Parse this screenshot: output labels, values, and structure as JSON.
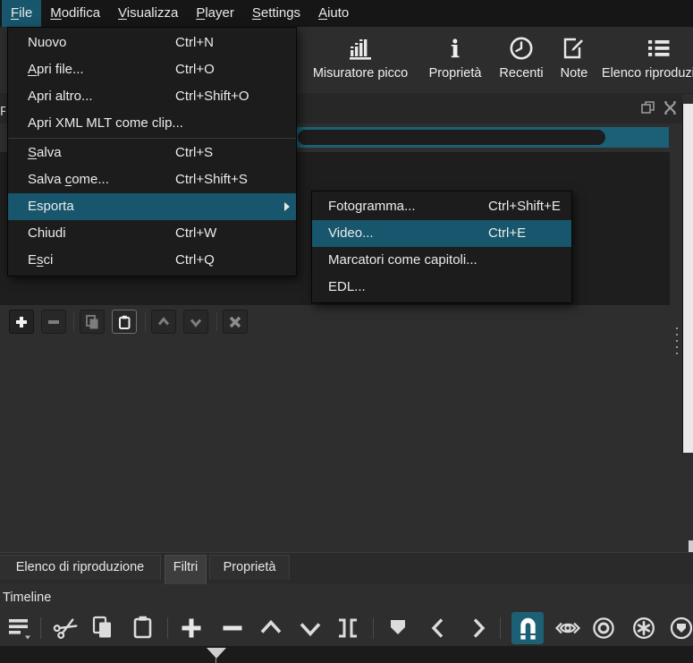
{
  "colors": {
    "accent_menu": "#17566c",
    "accent_search": "#1c6075",
    "menubar_bg": "#161616",
    "menu_bg": "#1c1c1c",
    "panel_bg": "#2e2e2e",
    "dark_list_bg": "#1e1e1e",
    "timeline_strip_bg": "#1b1b1b"
  },
  "menubar": {
    "items": [
      {
        "pre": "",
        "key": "F",
        "post": "ile"
      },
      {
        "pre": "",
        "key": "M",
        "post": "odifica"
      },
      {
        "pre": "",
        "key": "V",
        "post": "isualizza"
      },
      {
        "pre": "",
        "key": "P",
        "post": "layer"
      },
      {
        "pre": "",
        "key": "S",
        "post": "ettings"
      },
      {
        "pre": "",
        "key": "A",
        "post": "iuto"
      }
    ]
  },
  "toolbar": {
    "items": [
      {
        "label": "Misuratore picco",
        "icon": "peak-meter-icon"
      },
      {
        "label": "Proprietà",
        "icon": "info-icon"
      },
      {
        "label": "Recenti",
        "icon": "clock-icon"
      },
      {
        "label": "Note",
        "icon": "note-icon"
      },
      {
        "label": "Elenco riproduzione",
        "icon": "playlist-icon"
      }
    ]
  },
  "file_menu": {
    "items": [
      {
        "pre": "Nuovo",
        "key": "",
        "post": "",
        "shortcut": "Ctrl+N"
      },
      {
        "pre": "",
        "key": "A",
        "post": "pri file...",
        "shortcut": "Ctrl+O"
      },
      {
        "pre": "Apri altro...",
        "key": "",
        "post": "",
        "shortcut": "Ctrl+Shift+O"
      },
      {
        "pre": "Apri XML MLT come clip...",
        "key": "",
        "post": "",
        "shortcut": ""
      },
      {
        "pre": "",
        "key": "S",
        "post": "alva",
        "shortcut": "Ctrl+S"
      },
      {
        "pre": "Salva ",
        "key": "c",
        "post": "ome...",
        "shortcut": "Ctrl+Shift+S"
      },
      {
        "pre": "Esporta",
        "key": "",
        "post": "",
        "shortcut": "",
        "has_submenu": true,
        "highlighted": true
      },
      {
        "pre": "Chiudi",
        "key": "",
        "post": "",
        "shortcut": "Ctrl+W"
      },
      {
        "pre": "E",
        "key": "s",
        "post": "ci",
        "shortcut": "Ctrl+Q"
      }
    ]
  },
  "export_submenu": {
    "items": [
      {
        "label": "Fotogramma...",
        "shortcut": "Ctrl+Shift+E"
      },
      {
        "label": "Video...",
        "shortcut": "Ctrl+E",
        "highlighted": true
      },
      {
        "label": "Marcatori come capitoli...",
        "shortcut": ""
      },
      {
        "label": "EDL...",
        "shortcut": ""
      }
    ]
  },
  "filters_panel": {
    "header_fragment": "F",
    "search_value": "",
    "window_controls": [
      "float-icon",
      "close-icon"
    ],
    "buttons": [
      "add-filter",
      "remove-filter",
      "copy-filter",
      "paste-filter",
      "move-filter-up",
      "move-filter-down",
      "deselect-filter"
    ]
  },
  "tabs": {
    "items": [
      {
        "label": "Elenco di riproduzione"
      },
      {
        "label": "Filtri",
        "active": true
      },
      {
        "label": "Proprietà"
      }
    ]
  },
  "timeline": {
    "title": "Timeline",
    "snap_active": true,
    "icons": [
      "timeline-menu-icon",
      "cut-icon",
      "copy-icon",
      "paste-icon",
      "append-icon",
      "ripple-delete-icon",
      "lift-icon",
      "overwrite-icon",
      "split-icon",
      "marker-icon",
      "prev-marker-icon",
      "next-marker-icon",
      "snap-icon",
      "scrub-while-dragging-icon",
      "ripple-icon",
      "ripple-all-tracks-icon",
      "ripple-markers-icon"
    ]
  }
}
